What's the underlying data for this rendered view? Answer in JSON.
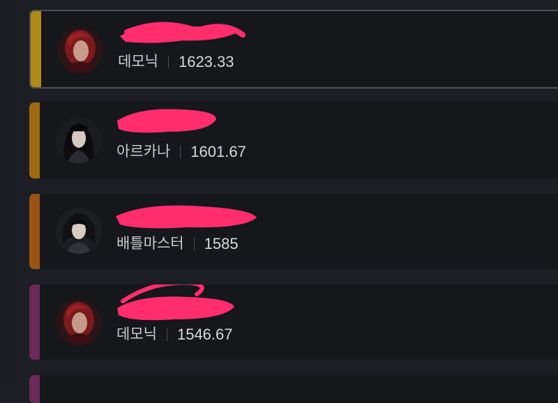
{
  "colors": {
    "background": "#1c1e23",
    "card": "#15171b",
    "selected_border": "#4c5058",
    "scribble": "#ff2d6e"
  },
  "entries": [
    {
      "class_name": "데모닉",
      "score": "1623.33",
      "stripe_color": "#b08a18",
      "selected": true,
      "avatar_icon": "red-hair-character-icon"
    },
    {
      "class_name": "아르카나",
      "score": "1601.67",
      "stripe_color": "#9e6a14",
      "selected": false,
      "avatar_icon": "black-hair-character-icon"
    },
    {
      "class_name": "배틀마스터",
      "score": "1585",
      "stripe_color": "#9a5316",
      "selected": false,
      "avatar_icon": "dark-hair-character-icon"
    },
    {
      "class_name": "데모닉",
      "score": "1546.67",
      "stripe_color": "#6a2a5a",
      "selected": false,
      "avatar_icon": "red-hair-character-icon"
    }
  ]
}
